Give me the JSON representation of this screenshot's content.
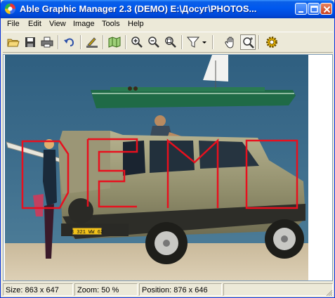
{
  "window": {
    "title": "Able Graphic Manager 2.3 (DEMO) E:\\Досуг\\PHOTOS...",
    "title_bar_color": "#0058ee",
    "controls": {
      "minimize": "minimize-icon",
      "maximize": "maximize-icon",
      "close": "close-icon"
    }
  },
  "menu": {
    "items": [
      {
        "label": "File"
      },
      {
        "label": "Edit"
      },
      {
        "label": "View"
      },
      {
        "label": "Image"
      },
      {
        "label": "Tools"
      },
      {
        "label": "Help"
      }
    ]
  },
  "toolbar": {
    "buttons": [
      {
        "icon": "open-folder-icon"
      },
      {
        "icon": "save-disk-icon"
      },
      {
        "icon": "print-icon"
      },
      {
        "icon": "undo-icon"
      },
      {
        "icon": "scanner-icon"
      },
      {
        "icon": "map-icon"
      },
      {
        "icon": "zoom-in-icon"
      },
      {
        "icon": "zoom-out-icon"
      },
      {
        "icon": "zoom-fit-icon"
      },
      {
        "icon": "filter-funnel-icon"
      },
      {
        "icon": "dropdown-arrow-icon"
      },
      {
        "icon": "pan-hand-icon"
      },
      {
        "icon": "zoom-tool-icon",
        "pressed": true
      },
      {
        "icon": "settings-gear-icon"
      }
    ]
  },
  "image": {
    "watermark_text": "DEMO",
    "watermark_color": "#e8101e",
    "license_plate": "8 321 WW 62"
  },
  "status": {
    "size": "Size: 863 x 647",
    "zoom": "Zoom: 50 %",
    "position": "Position: 876 x 646"
  }
}
